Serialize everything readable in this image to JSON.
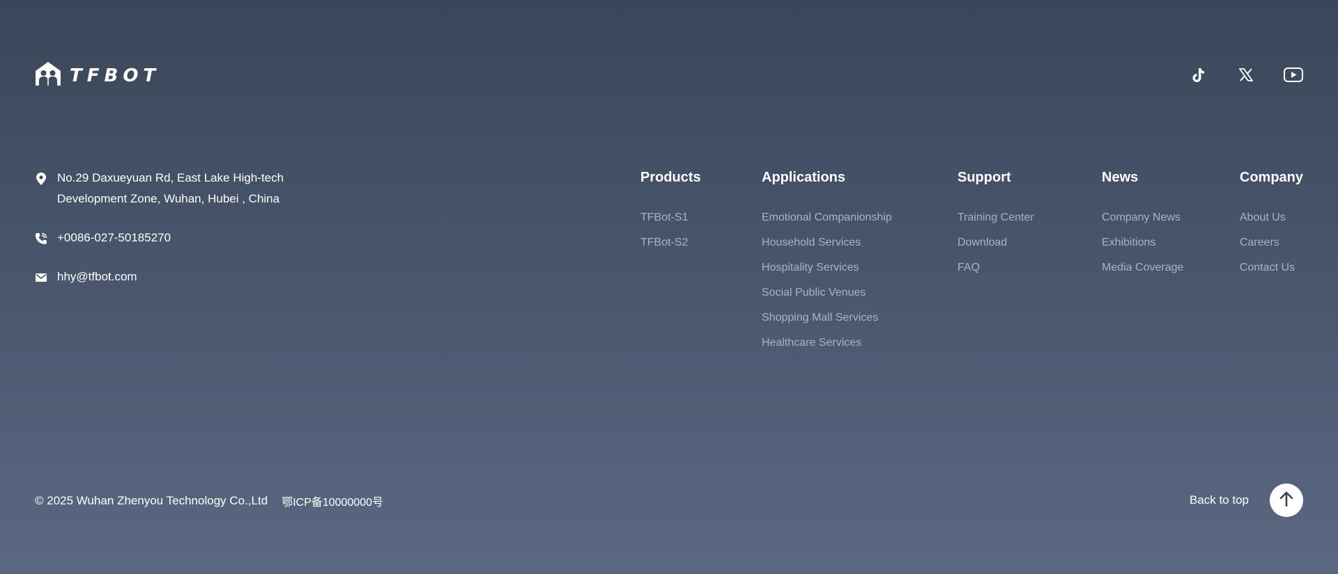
{
  "brand": {
    "name": "TFBOT",
    "logo_icon": "house-family-icon"
  },
  "social": [
    {
      "name": "TikTok",
      "icon": "tiktok-icon"
    },
    {
      "name": "X",
      "icon": "x-icon"
    },
    {
      "name": "YouTube",
      "icon": "youtube-icon"
    }
  ],
  "contact": {
    "address": "No.29 Daxueyuan Rd, East Lake High-tech Development Zone, Wuhan, Hubei , China",
    "phone": "+0086-027-50185270",
    "email": "hhy@tfbot.com"
  },
  "nav": {
    "products": {
      "title": "Products",
      "items": [
        "TFBot-S1",
        "TFBot-S2"
      ]
    },
    "applications": {
      "title": "Applications",
      "items": [
        "Emotional Companionship",
        "Household Services",
        "Hospitality Services",
        "Social Public Venues",
        "Shopping Mall Services",
        "Healthcare Services"
      ]
    },
    "support": {
      "title": "Support",
      "items": [
        "Training Center",
        "Download",
        "FAQ"
      ]
    },
    "news": {
      "title": "News",
      "items": [
        "Company News",
        "Exhibitions",
        "Media Coverage"
      ]
    },
    "company": {
      "title": "Company",
      "items": [
        "About Us",
        "Careers",
        "Contact Us"
      ]
    }
  },
  "footer": {
    "copyright": "© 2025 Wuhan Zhenyou Technology Co.,Ltd",
    "icp": "鄂ICP备10000000号",
    "back_to_top": "Back to top"
  },
  "colors": {
    "bg_top": "#3a4659",
    "bg_bottom": "#5b6882",
    "text": "#ffffff",
    "link_muted": "#aab3c2",
    "button_bg": "#ffffff",
    "button_icon": "#3a4659"
  }
}
